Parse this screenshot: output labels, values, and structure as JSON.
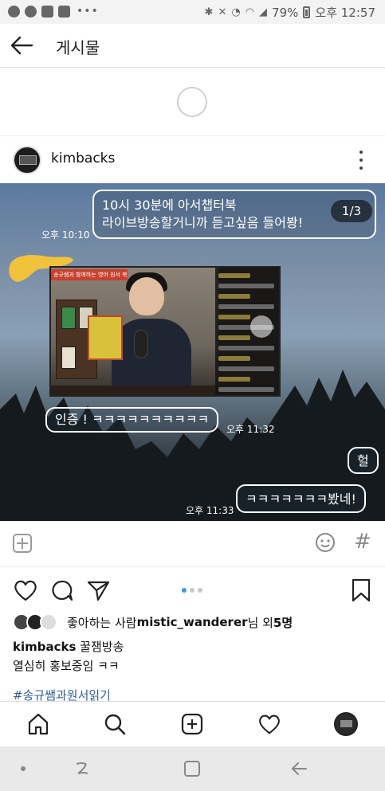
{
  "status_bar": {
    "battery": "79%",
    "time": "오후 12:57",
    "more": "•••"
  },
  "nav": {
    "title": "게시물"
  },
  "post": {
    "username": "kimbacks",
    "page_counter": "1/3",
    "bubble1_line1": "10시 30분에 아서챕터북",
    "bubble1_line2": "라이브방송할거니까 듣고싶음 들어봥!",
    "ts1": "오후 10:10",
    "bubble2": "인증 ! ㅋㅋㅋㅋㅋㅋㅋㅋㅋㅋ",
    "ts2": "오후 11:32",
    "bubble3": "헐",
    "bubble4": "ㅋㅋㅋㅋㅋㅋㅋ봤네!",
    "ts3": "오후 11:33",
    "screenshot_banner": "송규쌤과 함께하는 영어 원서 북클럽"
  },
  "likes": {
    "prefix": "좋아하는 사람 ",
    "user": "mistic_wanderer",
    "middle": "님 외 ",
    "count": "5명"
  },
  "caption": {
    "username": "kimbacks",
    "text1": " 꿀잼방송",
    "text2": "열심히 홍보중임 ㅋㅋ"
  },
  "hashtag": "#송규쌤과원서읽기",
  "icons": {
    "back": "back-arrow-icon",
    "more": "more-vertical-icon",
    "add": "add-media-icon",
    "emoji": "emoji-icon",
    "hash": "hashtag-icon",
    "heart": "heart-icon",
    "comment": "comment-icon",
    "share": "share-icon",
    "bookmark": "bookmark-icon"
  },
  "colors": {
    "accent": "#3897f0",
    "hashtag": "#2f5f9a"
  }
}
